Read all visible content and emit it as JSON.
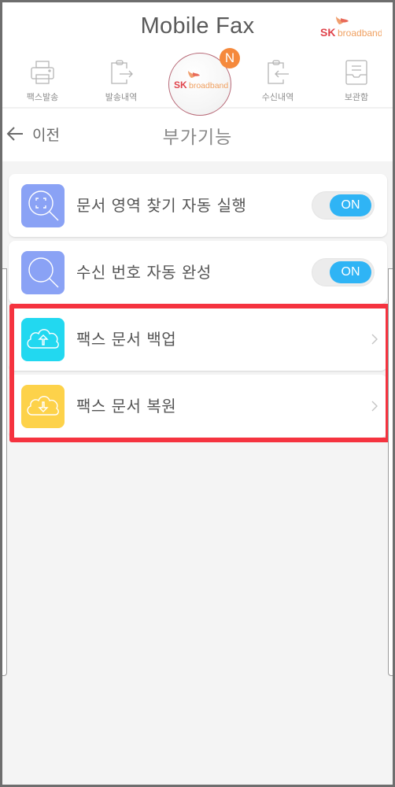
{
  "header": {
    "app_title": "Mobile Fax",
    "brand_logo": {
      "mark": "SK",
      "text": "broadband",
      "mark_color": "#e0444c",
      "text_color": "#f0a060"
    }
  },
  "nav": {
    "items": [
      {
        "label": "팩스발송",
        "icon": "printer-icon"
      },
      {
        "label": "발송내역",
        "icon": "clipboard-send-icon"
      },
      {
        "label": "",
        "icon": "sk-broadband-home-icon",
        "badge": "N"
      },
      {
        "label": "수신내역",
        "icon": "clipboard-receive-icon"
      },
      {
        "label": "보관함",
        "icon": "inbox-tray-icon"
      }
    ],
    "badge_color": "#f5893c"
  },
  "subbar": {
    "back_label": "이전",
    "title": "부가기능"
  },
  "settings": [
    {
      "label": "문서 영역 찾기 자동 실행",
      "icon": "document-area-search-icon",
      "type": "toggle",
      "state": "ON",
      "icon_color": "#8aa2f5"
    },
    {
      "label": "수신 번호 자동 완성",
      "icon": "search-icon",
      "type": "toggle",
      "state": "ON",
      "icon_color": "#8aa2f5"
    },
    {
      "label": "팩스 문서 백업",
      "icon": "cloud-upload-icon",
      "type": "link",
      "icon_color": "#22d8f0"
    },
    {
      "label": "팩스 문서 복원",
      "icon": "cloud-download-icon",
      "type": "link",
      "icon_color": "#fdd24a"
    }
  ],
  "colors": {
    "toggle_on": "#2fb4f5",
    "highlight": "#f5333f"
  }
}
